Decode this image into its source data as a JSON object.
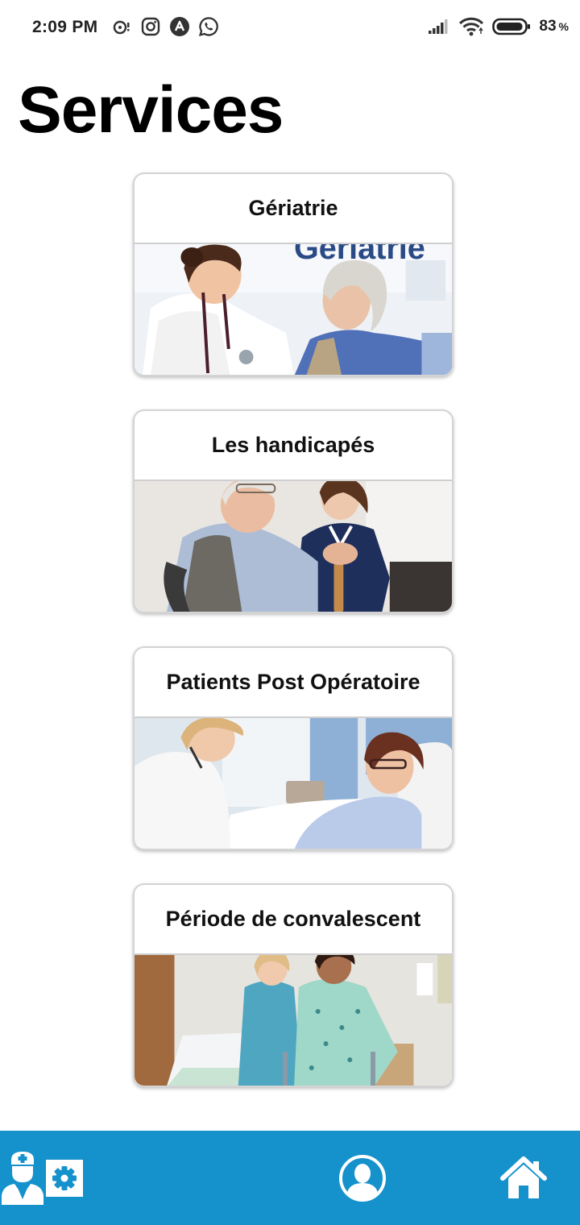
{
  "status_bar": {
    "time": "2:09 PM",
    "left_icons": [
      "notification-icon",
      "instagram-icon",
      "app-icon",
      "whatsapp-icon"
    ],
    "battery_percent": "83",
    "battery_unit": "%"
  },
  "page": {
    "title": "Services"
  },
  "services": [
    {
      "label": "Gériatrie",
      "image_text": "Geriatrie"
    },
    {
      "label": "Les handicapés"
    },
    {
      "label": "Patients Post Opératoire"
    },
    {
      "label": "Période de convalescent"
    }
  ],
  "bottom_nav": {
    "items": [
      "settings-icon",
      "nurse-icon",
      "profile-icon",
      "home-icon"
    ]
  },
  "colors": {
    "nav_background": "#1591cc",
    "nav_icon": "#ffffff"
  }
}
